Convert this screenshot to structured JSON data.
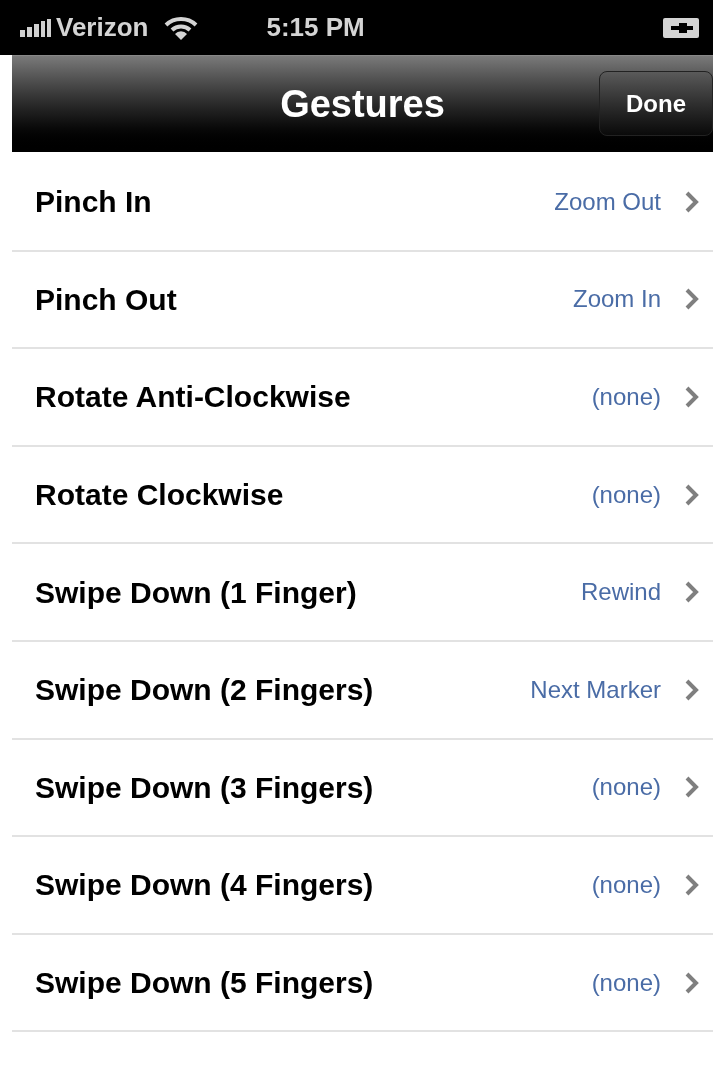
{
  "status_bar": {
    "carrier": "Verizon",
    "time": "5:15 PM"
  },
  "nav_bar": {
    "title": "Gestures",
    "button": "Done"
  },
  "rows": [
    {
      "label": "Pinch In",
      "value": "Zoom Out"
    },
    {
      "label": "Pinch Out",
      "value": "Zoom In"
    },
    {
      "label": "Rotate Anti-Clockwise",
      "value": "(none)"
    },
    {
      "label": "Rotate Clockwise",
      "value": "(none)"
    },
    {
      "label": "Swipe Down (1 Finger)",
      "value": "Rewind"
    },
    {
      "label": "Swipe Down (2 Fingers)",
      "value": "Next Marker"
    },
    {
      "label": "Swipe Down (3 Fingers)",
      "value": "(none)"
    },
    {
      "label": "Swipe Down (4 Fingers)",
      "value": "(none)"
    },
    {
      "label": "Swipe Down (5 Fingers)",
      "value": "(none)"
    }
  ]
}
